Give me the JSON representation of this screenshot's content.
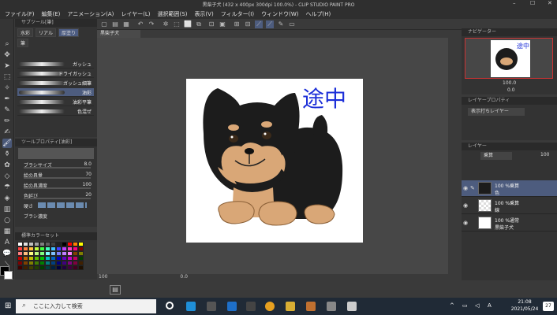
{
  "window": {
    "title": "黒柴子犬 (432 x 400px 300dpi 100.0%) - CLIP STUDIO PAINT PRO"
  },
  "menu": [
    "ファイル(F)",
    "編集(E)",
    "アニメーション(A)",
    "レイヤー(L)",
    "選択範囲(S)",
    "表示(V)",
    "フィルター(I)",
    "ウィンドウ(W)",
    "ヘルプ(H)"
  ],
  "subtool": {
    "header": "サブツール[筆]",
    "tabs": [
      "水彩",
      "リアル",
      "厚塗り"
    ],
    "group": "筆",
    "brushes": [
      "ガッシュ",
      "ドライガッシュ",
      "ガッシュ細筆",
      "油彩",
      "油彩平筆",
      "色混ぜ"
    ]
  },
  "tool_property": {
    "header": "ツールプロパティ[油彩]",
    "rows": [
      {
        "label": "ブラシサイズ",
        "value": "8.0"
      },
      {
        "label": "絵の具量",
        "value": "70"
      },
      {
        "label": "絵の具濃度",
        "value": "100"
      },
      {
        "label": "色延び",
        "value": "20"
      },
      {
        "label": "硬さ",
        "value": ""
      },
      {
        "label": "ブラシ濃度",
        "value": ""
      }
    ]
  },
  "color_set": {
    "header": "標準カラーセット",
    "swatches": [
      "#ffffff",
      "#e0e0e0",
      "#c0c0c0",
      "#a0a0a0",
      "#808080",
      "#606060",
      "#404040",
      "#202020",
      "#000000",
      "#ff0000",
      "#ff8000",
      "#ffff00",
      "#ff4040",
      "#ff8040",
      "#ffc040",
      "#c0ff40",
      "#40ff40",
      "#40ffc0",
      "#40c0ff",
      "#4040ff",
      "#c040ff",
      "#ff40c0",
      "#ff0080",
      "#800000",
      "#ff8080",
      "#ffc080",
      "#ffff80",
      "#c0ff80",
      "#80ff80",
      "#80ffff",
      "#80c0ff",
      "#8080ff",
      "#c080ff",
      "#ff80ff",
      "#804000",
      "#808000",
      "#c00000",
      "#c06000",
      "#c0c000",
      "#60c000",
      "#00c000",
      "#00c0c0",
      "#0060c0",
      "#0000c0",
      "#6000c0",
      "#c000c0",
      "#c00060",
      "#004000",
      "#800000",
      "#804000",
      "#808000",
      "#408000",
      "#008000",
      "#008080",
      "#004080",
      "#000080",
      "#400080",
      "#800080",
      "#800040",
      "#402000",
      "#400000",
      "#402000",
      "#404000",
      "#204000",
      "#004000",
      "#004040",
      "#002040",
      "#000040",
      "#200040",
      "#400040",
      "#400020",
      "#201000"
    ]
  },
  "canvas": {
    "tab_label": "黒柴子犬",
    "annotation_text": "途中",
    "zoom_value": "100",
    "status_angle": "0.0"
  },
  "navigator": {
    "header": "ナビゲーター",
    "zoom": "100.0",
    "angle": "0.0",
    "thumb_text": "途中"
  },
  "layer_property": {
    "header": "レイヤープロパティ",
    "mode_label": "表示打ちレイヤー"
  },
  "layers": {
    "header": "レイヤー",
    "blend_mode": "乗算",
    "opacity": "100",
    "items": [
      {
        "line1": "100 %乗算",
        "line2": "色",
        "selected": true
      },
      {
        "line1": "100 %乗算",
        "line2": "線",
        "selected": false
      },
      {
        "line1": "100 %通常",
        "line2": "黒柴子犬",
        "selected": false
      }
    ]
  },
  "taskbar": {
    "search_placeholder": "ここに入力して検索",
    "time": "21:08",
    "date": "2021/05/24",
    "notification_count": "27"
  },
  "colors": {
    "accent": "#4d5c7e",
    "panel": "#333333",
    "taskbar": "#202a36"
  }
}
